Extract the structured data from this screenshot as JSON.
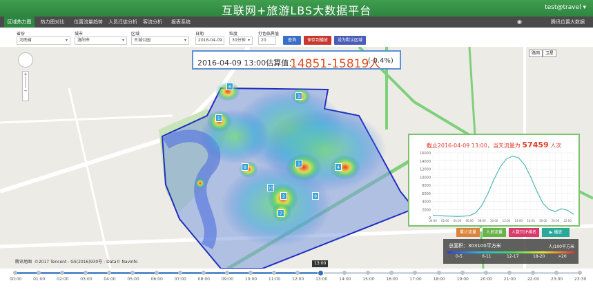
{
  "header": {
    "title": "互联网+旅游LBS大数据平台",
    "user": "test@travel ▾"
  },
  "nav": {
    "tabs": [
      "区域热力图",
      "热力图对比",
      "位置流量趋势",
      "人员迁徙分析",
      "客流分析",
      "报表系统"
    ],
    "active_index": 0,
    "brand": "腾讯位置大数据"
  },
  "filters": {
    "province_label": "省份",
    "province_value": "河南省",
    "city_label": "城市",
    "city_value": "洛阳市",
    "area_label": "区域",
    "area_value": "王城公园",
    "date_label": "日期",
    "date_value": "2016-04-09",
    "granularity_label": "粒度",
    "granularity_value": "30分钟",
    "threshold_label": "打色临界值",
    "threshold_value": "20",
    "query_button": "查询",
    "save_button": "保存到播放",
    "default_area_button": "设为默认区域"
  },
  "estimate": {
    "datetime": "2016-04-09 13:00估算值：",
    "range": "14851-15819人",
    "change": "(-0.4%)"
  },
  "map": {
    "map_type": [
      "路网",
      "卫星"
    ],
    "markers": [
      "1",
      "2",
      "3",
      "4",
      "5",
      "6",
      "7",
      "8",
      "9",
      "10"
    ],
    "copyright": "©2017 Tencent - GS(2016)930号 - Data© NavInfo",
    "logo": "腾讯地图"
  },
  "chart": {
    "title_prefix": "截止2016-04-09 13:00，当天流量为",
    "title_value": "57459",
    "title_suffix": "人次",
    "chart_data": {
      "type": "line",
      "x": [
        "00:00",
        "01:00",
        "02:00",
        "03:00",
        "04:00",
        "05:00",
        "06:00",
        "07:00",
        "08:00",
        "09:00",
        "10:00",
        "11:00",
        "12:00",
        "13:00",
        "14:00",
        "15:00",
        "16:00",
        "17:00",
        "18:00",
        "19:00",
        "20:00",
        "21:00",
        "22:00",
        "23:00"
      ],
      "series": [
        {
          "values": [
            600,
            500,
            400,
            350,
            300,
            350,
            500,
            1200,
            3000,
            6000,
            9500,
            12500,
            14500,
            15200,
            14800,
            13000,
            10000,
            6500,
            3500,
            2000,
            1500,
            2200,
            1800,
            800
          ]
        }
      ],
      "ylim": [
        0,
        16000
      ],
      "yticks": [
        0,
        2000,
        4000,
        6000,
        8000,
        10000,
        12000,
        14000,
        16000
      ],
      "grid": true,
      "colors": {
        "line": "#4fb8b0"
      }
    },
    "buttons": [
      "累计流量",
      "人员流量",
      "人数TOP排名",
      "播放"
    ]
  },
  "legend": {
    "area": "总面积：303100平方米",
    "unit": "人/100平方米",
    "labels": [
      "0-5",
      "6-11",
      "12-17",
      "18-20",
      ">20"
    ]
  },
  "timeline": {
    "labels": [
      "00:00",
      "01:00",
      "02:00",
      "03:00",
      "04:00",
      "05:00",
      "06:00",
      "07:00",
      "08:00",
      "09:00",
      "10:00",
      "11:00",
      "12:00",
      "13:00",
      "14:00",
      "15:00",
      "16:00",
      "17:00",
      "18:00",
      "19:00",
      "20:00",
      "21:00",
      "22:00",
      "23:00",
      "23:30"
    ],
    "current": "13:00",
    "current_index": 13
  },
  "colors": {
    "brand_green": "#2e8540",
    "query_blue": "#3a6fc7",
    "save_red": "#c9372c",
    "default_purple": "#4a5bb8"
  }
}
